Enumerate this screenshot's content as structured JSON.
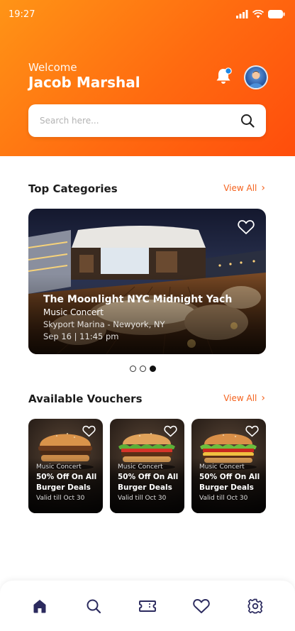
{
  "status_bar": {
    "time": "19:27"
  },
  "header": {
    "welcome": "Welcome",
    "user_name": "Jacob Marshal",
    "bell_icon": "bell-icon",
    "avatar_icon": "avatar"
  },
  "search": {
    "placeholder": "Search here...",
    "icon": "search-icon"
  },
  "top_categories": {
    "title": "Top Categories",
    "view_all": "View All",
    "featured": {
      "title": "The Moonlight NYC Midnight Yach",
      "category": "Music Concert",
      "location": "Skyport Marina - Newyork, NY",
      "date": "Sep 16",
      "separator": "|",
      "time": "11:45 pm"
    },
    "carousel": {
      "count": 3,
      "active_index": 2
    }
  },
  "vouchers": {
    "title": "Available Vouchers",
    "view_all": "View All",
    "items": [
      {
        "category": "Music Concert",
        "deal_line1": "50% Off On All",
        "deal_line2": "Burger Deals",
        "valid": "Valid till Oct 30"
      },
      {
        "category": "Music Concert",
        "deal_line1": "50% Off On All",
        "deal_line2": "Burger Deals",
        "valid": "Valid till Oct 30"
      },
      {
        "category": "Music Concert",
        "deal_line1": "50% Off On All",
        "deal_line2": "Burger Deals",
        "valid": "Valid till Oct 30"
      }
    ]
  },
  "bottom_nav": {
    "items": [
      "home-icon",
      "search-icon",
      "ticket-icon",
      "heart-icon",
      "settings-icon"
    ],
    "active": "home-icon"
  },
  "colors": {
    "accent": "#f4621d",
    "header_start": "#ff9416",
    "header_end": "#ff4d0c",
    "nav_icon": "#2b2a5e"
  }
}
